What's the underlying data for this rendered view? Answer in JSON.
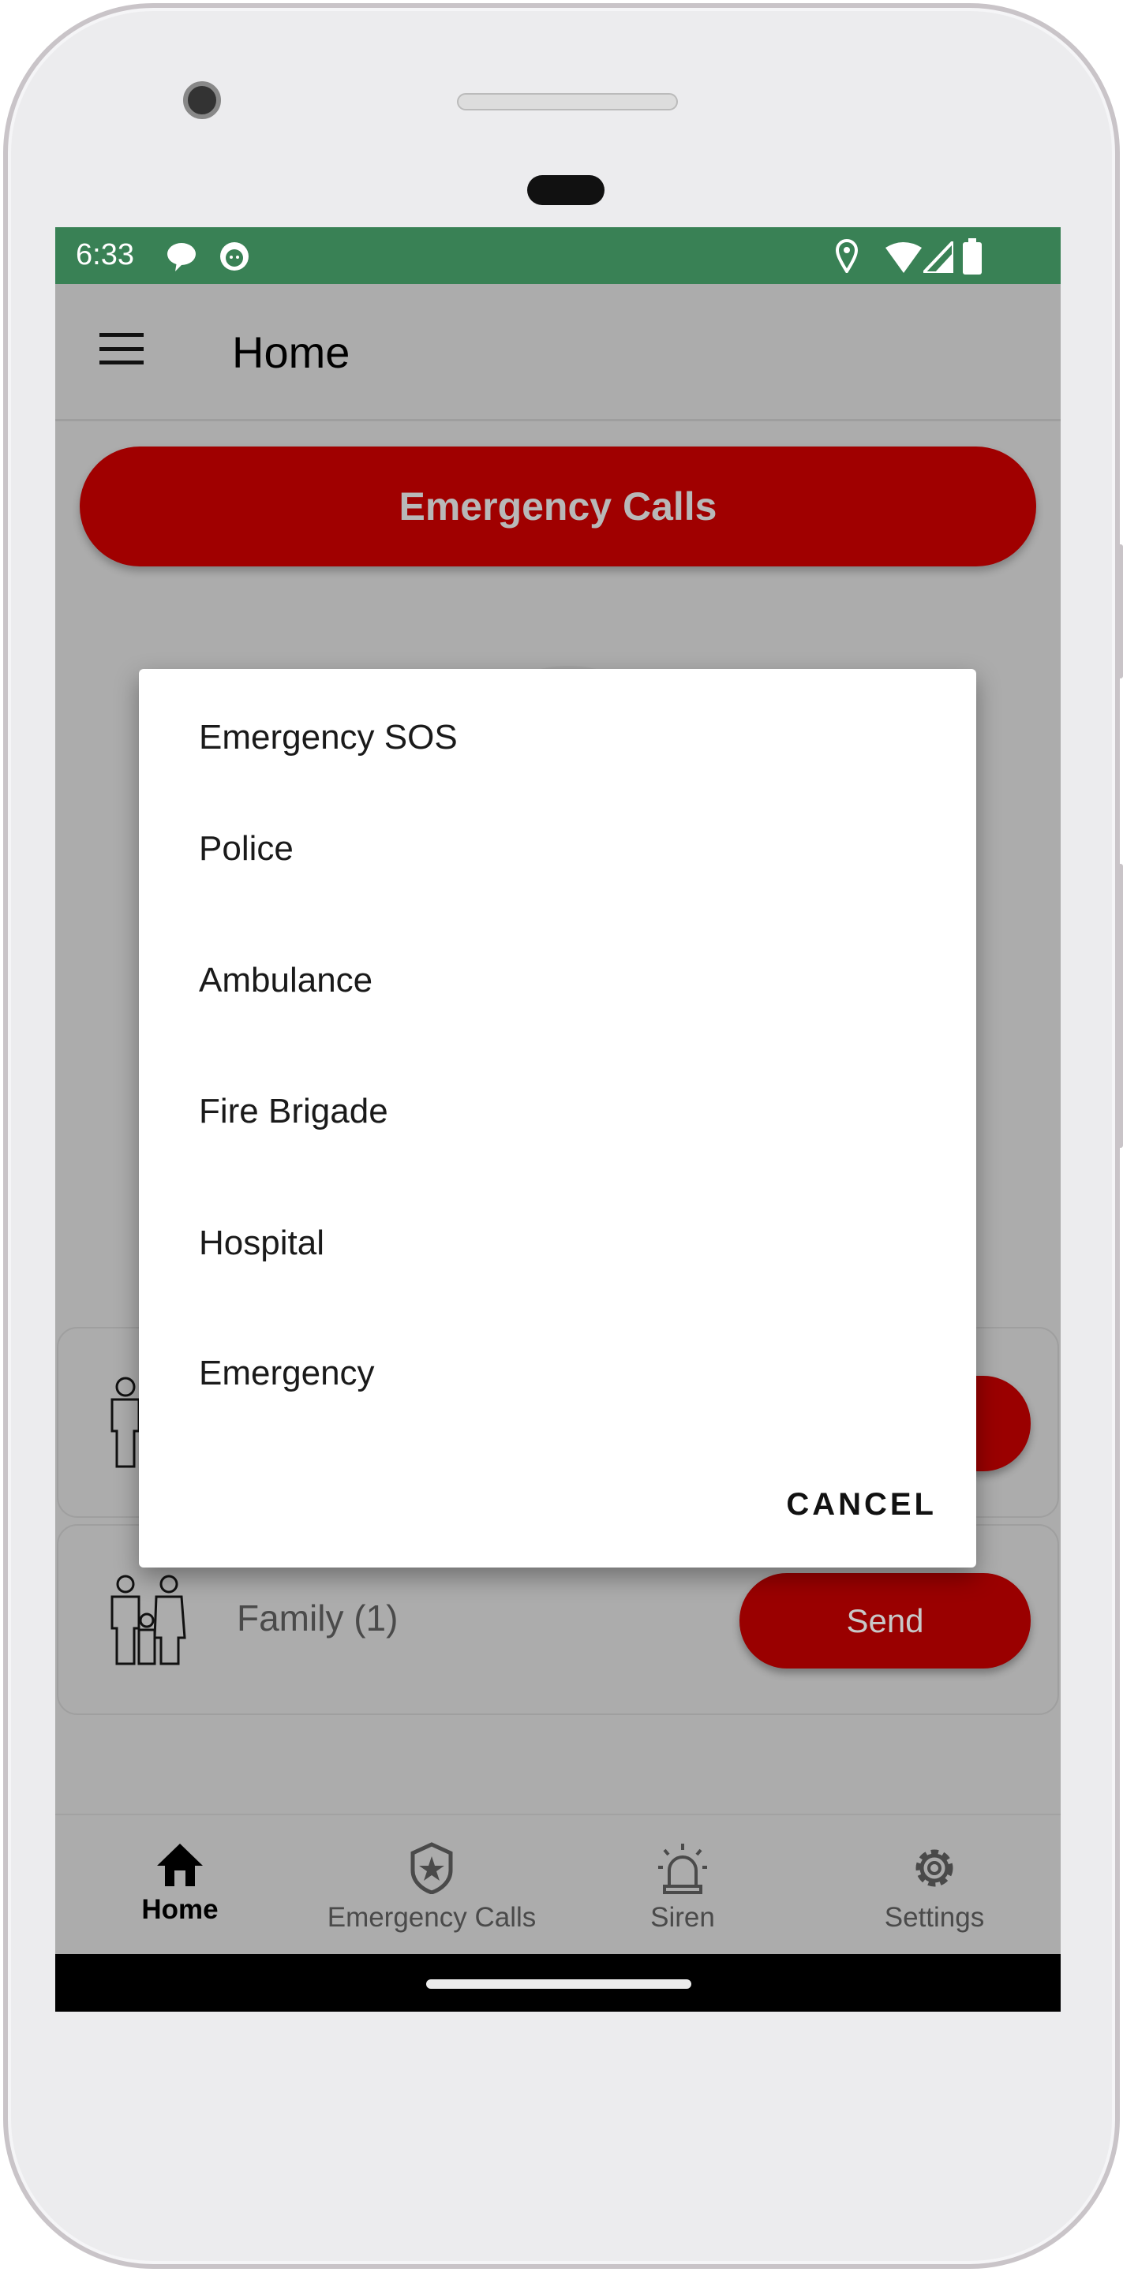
{
  "status_bar": {
    "time": "6:33",
    "left_icons": [
      "chat-bubble-icon",
      "cat-face-icon"
    ],
    "right_icons": [
      "location-icon",
      "wifi-icon",
      "signal-icon",
      "battery-icon"
    ],
    "color": "#398155"
  },
  "toolbar": {
    "title": "Home",
    "menu_icon": "hamburger-menu-icon"
  },
  "main": {
    "emergency_calls_button": "Emergency Calls",
    "cards": [
      {
        "label": "",
        "icon": "person-icon",
        "button": ""
      },
      {
        "label": "Family (1)",
        "icon": "family-icon",
        "button": "Send"
      }
    ],
    "accent": "#a00000"
  },
  "dialog": {
    "items": [
      "Emergency SOS",
      "Police",
      "Ambulance",
      "Fire Brigade",
      "Hospital",
      "Emergency"
    ],
    "cancel_label": "CANCEL"
  },
  "bottom_nav": {
    "items": [
      {
        "label": "Home",
        "icon": "home-icon",
        "active": true
      },
      {
        "label": "Emergency Calls",
        "icon": "shield-star-icon",
        "active": false
      },
      {
        "label": "Siren",
        "icon": "siren-icon",
        "active": false
      },
      {
        "label": "Settings",
        "icon": "gear-icon",
        "active": false
      }
    ]
  }
}
